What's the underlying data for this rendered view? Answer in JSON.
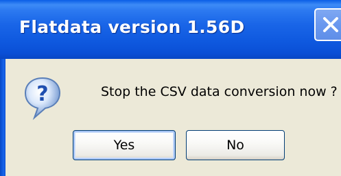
{
  "dialog": {
    "title": "Flatdata version 1.56D",
    "message": "Stop the CSV data conversion now ?",
    "icon": "question-icon",
    "buttons": {
      "yes_label": "Yes",
      "no_label": "No"
    },
    "close_icon": "close-icon",
    "colors": {
      "titlebar": "#0a55da",
      "body": "#ece9d8",
      "close_button": "#6a98ef"
    }
  }
}
